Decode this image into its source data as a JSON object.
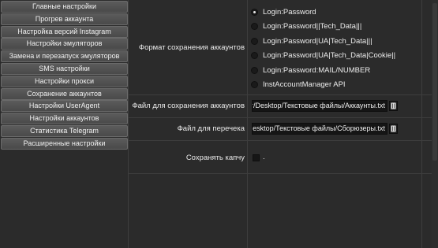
{
  "sidebar": {
    "items": [
      {
        "label": "Главные настройки"
      },
      {
        "label": "Прогрев аккаунта"
      },
      {
        "label": "Настройка версий Instagram"
      },
      {
        "label": "Настройки эмуляторов"
      },
      {
        "label": "Замена и перезапуск эмуляторов"
      },
      {
        "label": "SMS настройки"
      },
      {
        "label": "Настройки прокси"
      },
      {
        "label": "Сохранение аккаунтов"
      },
      {
        "label": "Настройки UserAgent"
      },
      {
        "label": "Настройки аккаунтов"
      },
      {
        "label": "Статистика Telegram"
      },
      {
        "label": "Расширенные настройки"
      }
    ]
  },
  "main": {
    "format": {
      "label": "Формат сохранения аккаунтов",
      "options": [
        {
          "label": "Login:Password",
          "selected": true
        },
        {
          "label": "Login:Password||Tech_Data|||",
          "selected": false
        },
        {
          "label": "Login:Password|UA|Tech_Data|||",
          "selected": false
        },
        {
          "label": "Login:Password|UA|Tech_Data|Cookie||",
          "selected": false
        },
        {
          "label": "Login:Password:MAIL/NUMBER",
          "selected": false
        },
        {
          "label": "InstAccountManager API",
          "selected": false
        }
      ]
    },
    "save_file": {
      "label": "Файл для сохранения аккаунтов",
      "value": "or/Desktop/Текстовые файлы/Аккаунты.txt"
    },
    "recheck_file": {
      "label": "Файл для перечека",
      "value": "Desktop/Текстовые файлы/Сборюзеры.txt"
    },
    "captcha": {
      "label": "Сохранять капчу",
      "value": "."
    }
  },
  "icons": {
    "browse": "folder-icon"
  }
}
